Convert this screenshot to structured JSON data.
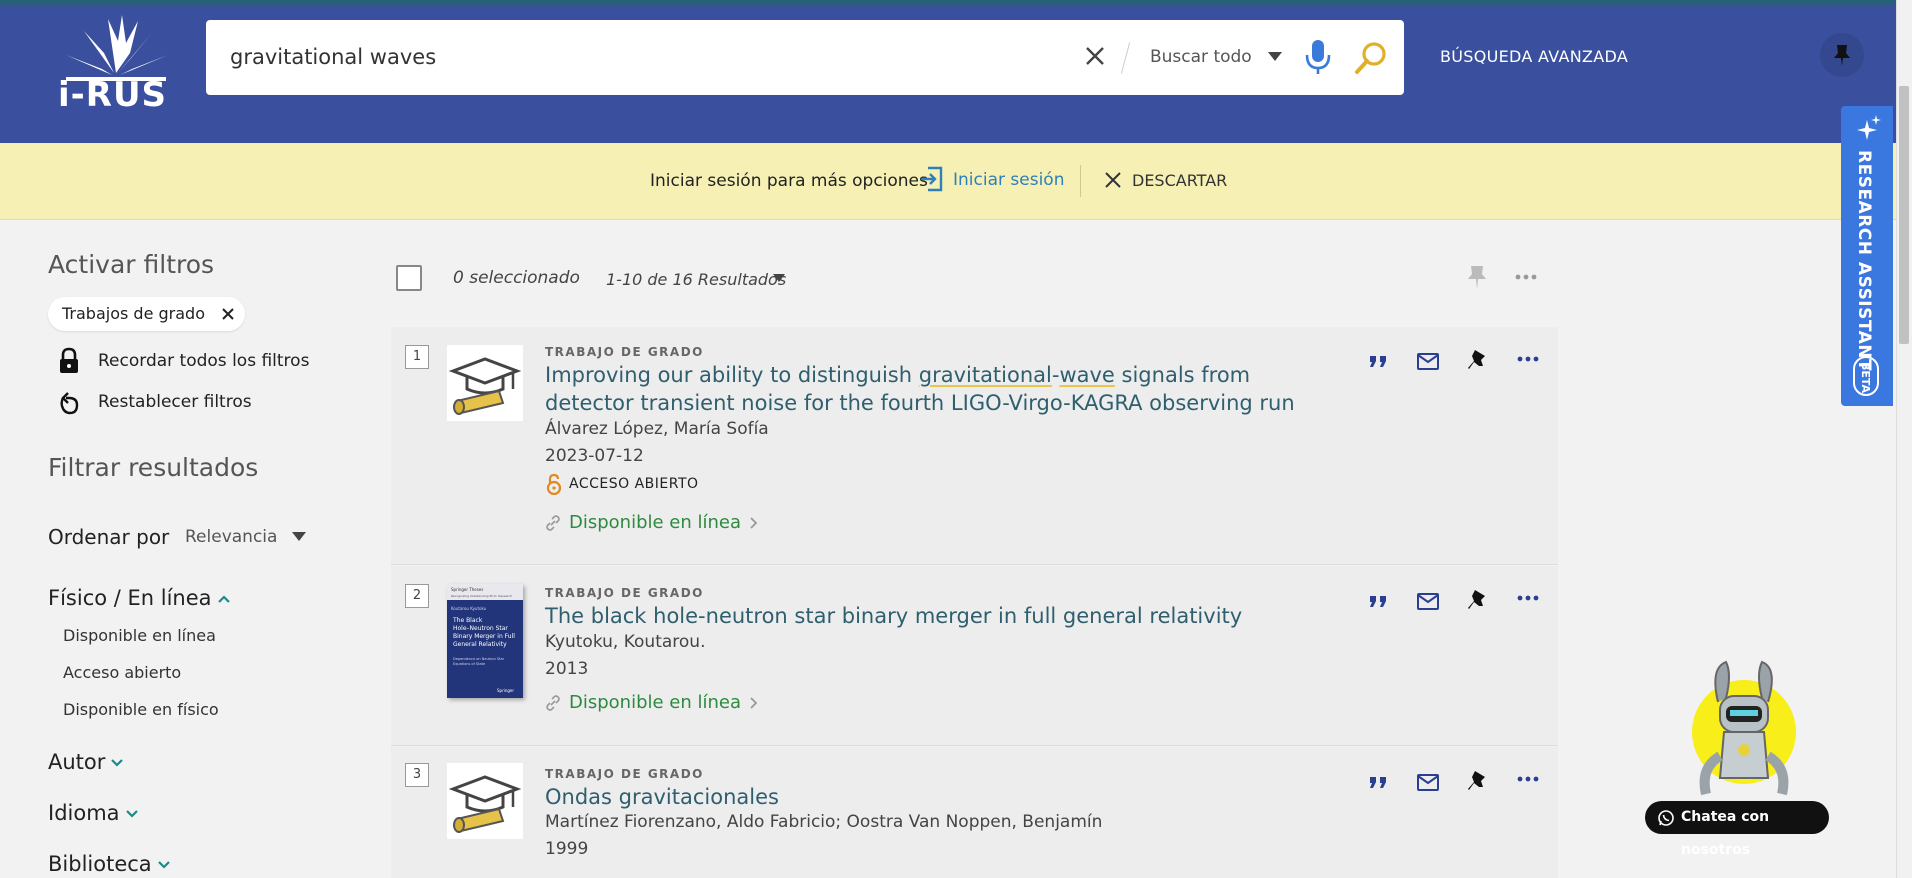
{
  "brand": {
    "logo_text": "i-RUS"
  },
  "search": {
    "query": "gravitational waves",
    "scope": "Buscar todo",
    "advanced_label": "BÚSQUEDA AVANZADA"
  },
  "login_bar": {
    "message": "Iniciar sesión para más opciones",
    "login_label": "Iniciar sesión",
    "dismiss_label": "DESCARTAR"
  },
  "research_assistant": {
    "label": "RESEARCH ASSISTANT",
    "badge": "BETA"
  },
  "sidebar": {
    "active_filters_heading": "Activar filtros",
    "active_filter_chip": "Trabajos de grado",
    "remember_filters": "Recordar todos los filtros",
    "reset_filters": "Restablecer filtros",
    "filter_heading": "Filtrar resultados",
    "sort_label": "Ordenar por",
    "sort_value": "Relevancia",
    "facets": [
      {
        "title": "Físico / En línea",
        "expanded": true,
        "items": [
          "Disponible en línea",
          "Acceso abierto",
          "Disponible en físico"
        ]
      },
      {
        "title": "Autor",
        "expanded": false
      },
      {
        "title": "Idioma",
        "expanded": false
      },
      {
        "title": "Biblioteca",
        "expanded": false
      }
    ]
  },
  "results_header": {
    "selected": "0 seleccionado",
    "range": "1-10 de 16 Resultados"
  },
  "results": [
    {
      "number": "1",
      "type": "TRABAJO DE GRADO",
      "title_parts": [
        "Improving our ability to distinguish ",
        "gravitational",
        "-",
        "wave",
        " signals from detector transient noise for the fourth LIGO-Virgo-KAGRA observing run"
      ],
      "author": "Álvarez López, María Sofía",
      "date": "2023-07-12",
      "open_access": "ACCESO ABIERTO",
      "availability": "Disponible en línea",
      "thumb": "graduation-cap-icon"
    },
    {
      "number": "2",
      "type": "TRABAJO DE GRADO",
      "title": "The black hole-neutron star binary merger in full general relativity",
      "author": "Kyutoku, Koutarou.",
      "date": "2013",
      "availability": "Disponible en línea",
      "cover": {
        "series": "Springer Theses",
        "subseries": "Recognizing Outstanding Ph.D. Research",
        "author": "Koutarou Kyutoku",
        "title_lines": [
          "The Black",
          "Hole–Neutron Star",
          "Binary Merger in Full",
          "General Relativity"
        ],
        "subtitle_lines": [
          "Dependence on Neutron Star",
          "Equations of State"
        ],
        "publisher": "Springer"
      }
    },
    {
      "number": "3",
      "type": "TRABAJO DE GRADO",
      "title": "Ondas gravitacionales",
      "author": "Martínez Fiorenzano, Aldo Fabricio; Oostra Van Noppen, Benjamín",
      "date": "1999",
      "thumb": "graduation-cap-icon"
    }
  ],
  "chat": {
    "label": "Chatea con nosotros"
  },
  "colors": {
    "header": "#3a4f9e",
    "login_bar": "#f6f0b5",
    "accent_link": "#2f7fb8",
    "available_green": "#2e8a3e",
    "title_teal": "#2f5f6e",
    "research_tab": "#3a78e0"
  }
}
